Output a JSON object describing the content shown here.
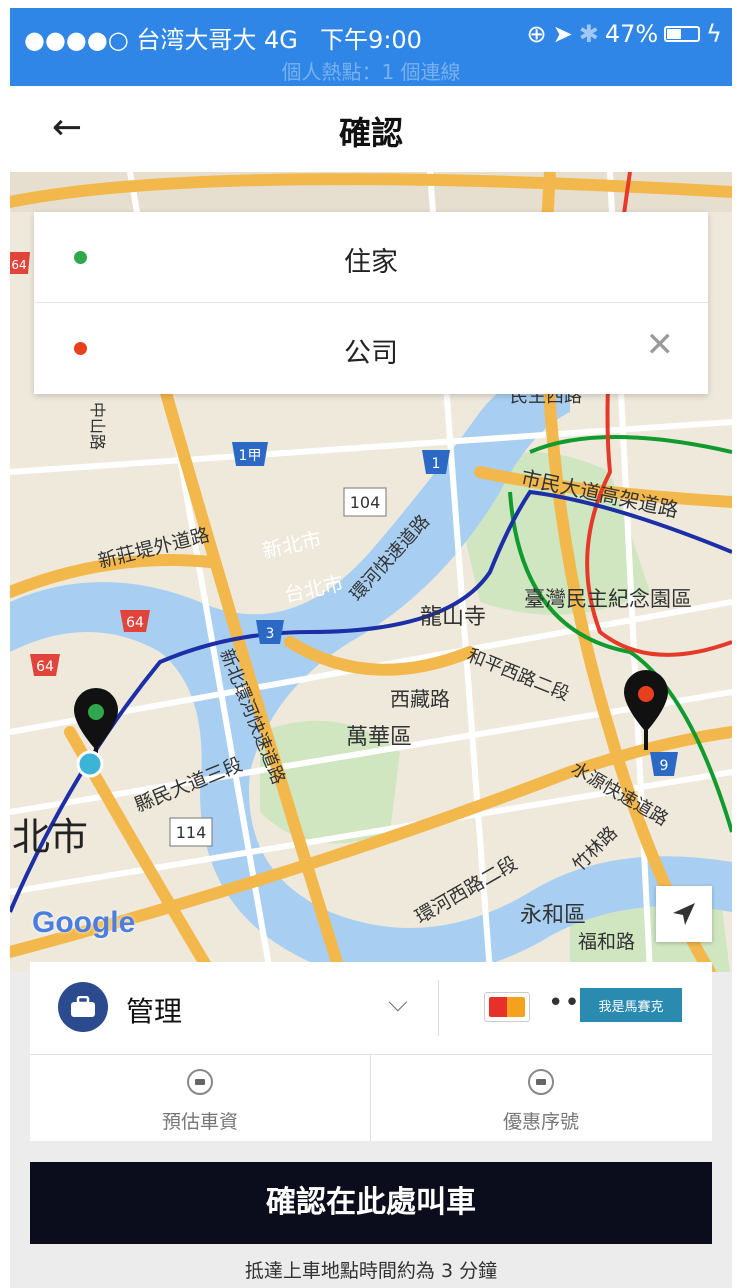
{
  "status_bar": {
    "carrier": "●●●●○ 台湾大哥大  4G",
    "time": "下午9:00",
    "battery": "47%",
    "hotspot": "個人熱點：1 個連線"
  },
  "nav": {
    "back_glyph": "←",
    "title": "確認"
  },
  "route": {
    "pickup": "住家",
    "dropoff": "公司",
    "clear_glyph": "✕",
    "pickup_color": "#2ea84a",
    "dropoff_color": "#e8401c"
  },
  "map": {
    "labels": [
      {
        "text": "新北市",
        "size": 20,
        "color": "#ffffff"
      },
      {
        "text": "台北市",
        "size": 20,
        "color": "#ffffff"
      },
      {
        "text": "龍山寺",
        "size": 22,
        "color": "#333333"
      },
      {
        "text": "西藏路",
        "size": 20,
        "color": "#333333"
      },
      {
        "text": "萬華區",
        "size": 22,
        "color": "#333333"
      },
      {
        "text": "臺灣民主紀念園區",
        "size": 21,
        "color": "#333333"
      },
      {
        "text": "市民大道高架道路",
        "size": 20,
        "color": "#333333"
      },
      {
        "text": "新莊堤外道路",
        "size": 19,
        "color": "#333333"
      },
      {
        "text": "縣民大道三段",
        "size": 19,
        "color": "#333333"
      },
      {
        "text": "北市",
        "size": 38,
        "color": "#222222"
      },
      {
        "text": "永和區",
        "size": 22,
        "color": "#333333"
      },
      {
        "text": "福和路",
        "size": 19,
        "color": "#333333"
      },
      {
        "text": "環河西路二段",
        "size": 19,
        "color": "#333333"
      },
      {
        "text": "和平西路二段",
        "size": 18,
        "color": "#333333"
      },
      {
        "text": "水源快速道路",
        "size": 18,
        "color": "#333333"
      },
      {
        "text": "環河快速道路",
        "size": 18,
        "color": "#333333"
      },
      {
        "text": "新北環河快速道路",
        "size": 18,
        "color": "#333333"
      },
      {
        "text": "竹林路",
        "size": 18,
        "color": "#333333"
      },
      {
        "text": "民生西路",
        "size": 18,
        "color": "#333333"
      },
      {
        "text": "中山路",
        "size": 16,
        "color": "#333333"
      }
    ],
    "road_shields": [
      "104",
      "114",
      "64",
      "64",
      "64",
      "1甲",
      "1",
      "3",
      "9"
    ],
    "google_logo": "Google"
  },
  "payment": {
    "profile_name": "管理",
    "dropdown_glyph": "⌵",
    "card_dots": "•••",
    "watermark": "我是馬賽克"
  },
  "options": {
    "fare_estimate": "預估車資",
    "promo_code": "優惠序號"
  },
  "confirm_button": "確認在此處叫車",
  "eta": "抵達上車地點時間約為 3 分鐘"
}
